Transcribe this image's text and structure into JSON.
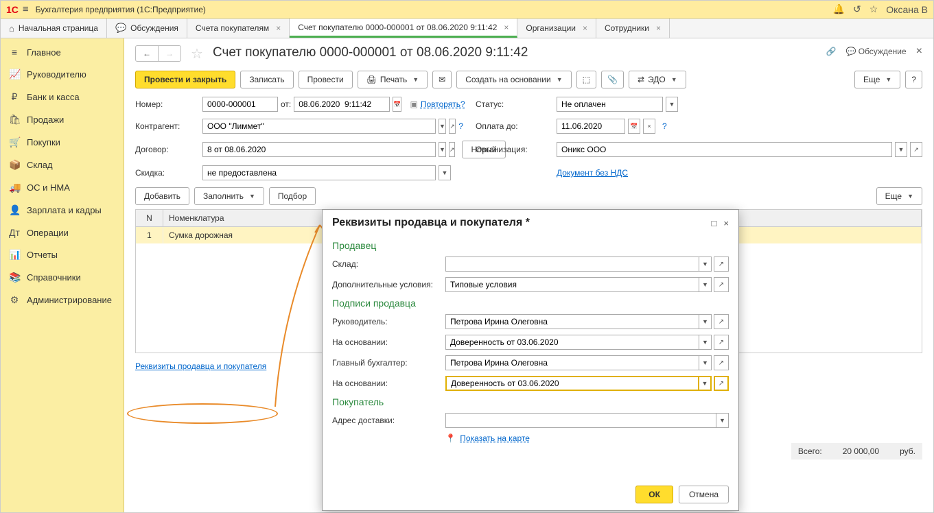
{
  "app": {
    "title": "Бухгалтерия предприятия  (1С:Предприятие)",
    "user": "Оксана В"
  },
  "tabs": {
    "home": "Начальная страница",
    "discussions": "Обсуждения",
    "invoices": "Счета покупателям",
    "current": "Счет покупателю 0000-000001 от 08.06.2020 9:11:42",
    "orgs": "Организации",
    "employees": "Сотрудники"
  },
  "sidebar": [
    {
      "icon": "≡",
      "label": "Главное"
    },
    {
      "icon": "📈",
      "label": "Руководителю"
    },
    {
      "icon": "₽",
      "label": "Банк и касса"
    },
    {
      "icon": "🛍",
      "label": "Продажи"
    },
    {
      "icon": "🛒",
      "label": "Покупки"
    },
    {
      "icon": "📦",
      "label": "Склад"
    },
    {
      "icon": "🚚",
      "label": "ОС и НМА"
    },
    {
      "icon": "👤",
      "label": "Зарплата и кадры"
    },
    {
      "icon": "Дт",
      "label": "Операции"
    },
    {
      "icon": "📊",
      "label": "Отчеты"
    },
    {
      "icon": "📚",
      "label": "Справочники"
    },
    {
      "icon": "⚙",
      "label": "Администрирование"
    }
  ],
  "doc": {
    "title": "Счет покупателю 0000-000001 от 08.06.2020 9:11:42",
    "discussion": "Обсуждение"
  },
  "toolbar": {
    "post_close": "Провести и закрыть",
    "save": "Записать",
    "post": "Провести",
    "print": "Печать",
    "create_based": "Создать на основании",
    "edo": "ЭДО",
    "more": "Еще"
  },
  "form": {
    "number_label": "Номер:",
    "number": "0000-000001",
    "from_label": "от:",
    "date": "08.06.2020  9:11:42",
    "repeat": "Повторять?",
    "status_label": "Статус:",
    "status": "Не оплачен",
    "contractor_label": "Контрагент:",
    "contractor": "ООО \"Лиммет\"",
    "payby_label": "Оплата до:",
    "payby": "11.06.2020",
    "contract_label": "Договор:",
    "contract": "8 от 08.06.2020",
    "new_btn": "Новый",
    "org_label": "Организация:",
    "org": "Оникс ООО",
    "discount_label": "Скидка:",
    "discount": "не предоставлена",
    "nds_link": "Документ без НДС"
  },
  "toolbar2": {
    "add": "Добавить",
    "fill": "Заполнить",
    "select": "Подбор",
    "more": "Еще"
  },
  "table": {
    "col_n": "N",
    "col_name": "Номенклатура",
    "rows": [
      {
        "n": "1",
        "name": "Сумка дорожная"
      }
    ]
  },
  "footer": {
    "seller_link": "Реквизиты продавца и покупателя",
    "total_label": "Всего:",
    "total_value": "20 000,00",
    "currency": "руб."
  },
  "modal": {
    "title": "Реквизиты продавца и покупателя *",
    "seller_section": "Продавец",
    "warehouse_label": "Склад:",
    "warehouse": "",
    "conditions_label": "Дополнительные условия:",
    "conditions": "Типовые условия",
    "signatures_section": "Подписи продавца",
    "manager_label": "Руководитель:",
    "manager": "Петрова Ирина Олеговна",
    "basis1_label": "На основании:",
    "basis1": "Доверенность от 03.06.2020",
    "accountant_label": "Главный бухгалтер:",
    "accountant": "Петрова Ирина Олеговна",
    "basis2_label": "На основании:",
    "basis2": "Доверенность от 03.06.2020",
    "buyer_section": "Покупатель",
    "address_label": "Адрес доставки:",
    "address": "",
    "map_link": "Показать на карте",
    "ok": "ОК",
    "cancel": "Отмена"
  }
}
